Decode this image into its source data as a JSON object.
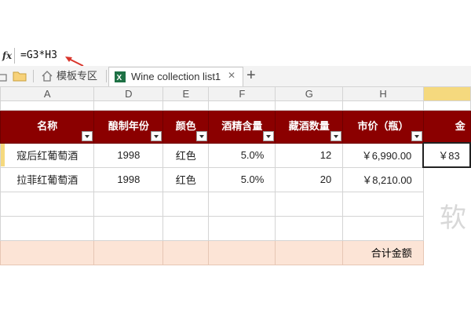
{
  "formula_bar": {
    "fx_label": "fx",
    "formula": "=G3*H3"
  },
  "tabs": {
    "template_tab": "模板专区",
    "active_tab": "Wine collection list1",
    "new_tab": "+"
  },
  "columns": [
    "A",
    "D",
    "E",
    "F",
    "G",
    "H",
    ""
  ],
  "headers": [
    "名称",
    "酿制年份",
    "颜色",
    "酒精含量",
    "藏酒数量",
    "市价（瓶）",
    "金"
  ],
  "rows": [
    [
      "寇后红葡萄酒",
      "1998",
      "红色",
      "5.0%",
      "12",
      "￥6,990.00",
      "￥83"
    ],
    [
      "拉菲红葡萄酒",
      "1998",
      "红色",
      "5.0%",
      "20",
      "￥8,210.00",
      ""
    ]
  ],
  "total_label": "合计金额",
  "watermark": "软",
  "colors": {
    "header_bg": "#8b0000",
    "header_text": "#ffffff",
    "total_bg": "#fce4d6",
    "selected_col": "#f5d97e",
    "excel_green": "#1e7145"
  }
}
